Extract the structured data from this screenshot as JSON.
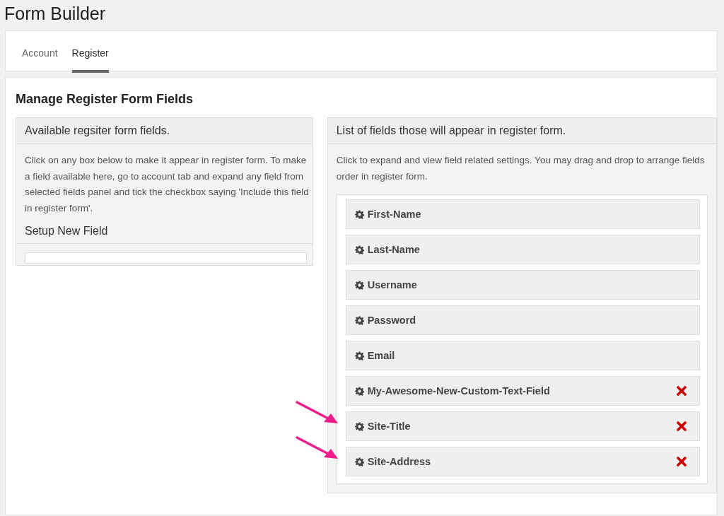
{
  "page_title": "Form Builder",
  "tabs": [
    {
      "label": "Account",
      "selected": false
    },
    {
      "label": "Register",
      "selected": true
    }
  ],
  "heading": "Manage Register Form Fields",
  "available_panel": {
    "title": "Available regsiter form fields.",
    "description": "Click on any box below to make it appear in register form. To make a field available here, go to account tab and expand any field from selected fields panel and tick the checkbox saying 'Include this field in register form'.",
    "subheading": "Setup New Field"
  },
  "selected_panel": {
    "title": "List of fields those will appear in register form.",
    "description": "Click to expand and view field related settings. You may drag and drop to arrange fields order in register form.",
    "fields": [
      {
        "label": "First-Name",
        "removable": false,
        "annotated": false
      },
      {
        "label": "Last-Name",
        "removable": false,
        "annotated": false
      },
      {
        "label": "Username",
        "removable": false,
        "annotated": false
      },
      {
        "label": "Password",
        "removable": false,
        "annotated": false
      },
      {
        "label": "Email",
        "removable": false,
        "annotated": false
      },
      {
        "label": "My-Awesome-New-Custom-Text-Field",
        "removable": true,
        "annotated": false
      },
      {
        "label": "Site-Title",
        "removable": true,
        "annotated": true
      },
      {
        "label": "Site-Address",
        "removable": true,
        "annotated": true
      }
    ]
  }
}
